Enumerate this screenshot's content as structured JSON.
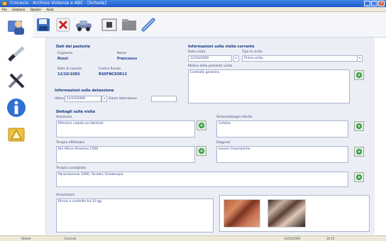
{
  "window": {
    "title": "Crocevia - Archivio Violenze e ABC - [Scheda]",
    "controls": [
      "_",
      "□",
      "×"
    ]
  },
  "menu": {
    "items": [
      "File",
      "Gestione",
      "Opzioni",
      "Aiuto"
    ]
  },
  "sidebar": {
    "buttons": [
      "users-icon",
      "syringe-icon",
      "tools-icon",
      "info-icon",
      "warning-icon"
    ]
  },
  "toolbar": {
    "buttons": [
      "save-icon",
      "delete-icon",
      "car-icon",
      "film-icon",
      "folder-icon",
      "pencil-icon"
    ]
  },
  "paziente": {
    "section_title": "Dati del paziente",
    "cognome_label": "Cognome",
    "cognome_value": "Rossi",
    "nome_label": "Nome",
    "nome_value": "Francesco",
    "data_nascita_label": "Data di nascita",
    "data_nascita_value": "12/10/1983",
    "codice_fiscale_label": "Codice fiscale",
    "codice_fiscale_value": "RSSFNC83R12"
  },
  "detenzione": {
    "section_title": "Informazioni sulla detenzione",
    "ultimo_label": "Ultimo",
    "ultimo_value": "12/10/2009",
    "arresti_label": "Giorni detenzione",
    "arresti_value": ""
  },
  "visita_corrente": {
    "section_title": "Informazioni sulla visita corrente",
    "data_label": "Data visita",
    "data_value": "12/10/2009",
    "tipo_label": "Tipo di visita",
    "tipo_value": "Prima visita",
    "motivo_label": "Motivo della presente visita",
    "motivo_value": "Controllo generico"
  },
  "dettagli_visita": {
    "section_title": "Dettagli sulla visita",
    "anamnesi_label": "Anamnesi",
    "anamnesi_value": "Riferisce caduta accidentale",
    "sintomatologia_label": "Sintomatologia riferita",
    "sintomatologia_value": "Cefalea",
    "terapia_label": "Terapia effettuata",
    "terapia_value": "Bio Attiva Vitamine C500",
    "diagnosi_label": "Diagnosi",
    "diagnosi_value": "Lesioni traumatiche",
    "terapia_consigliata_label": "Terapia consigliata",
    "terapia_consigliata_value": "Paracetamolo 1000; Toradol; Fisioterapia"
  },
  "annotazioni": {
    "label": "Annotazioni",
    "value": "Rinvio a controllo fra 10 gg"
  },
  "status": {
    "left": "Utente",
    "center": "Crocevia",
    "date": "12/10/2009",
    "time": "10:15"
  }
}
